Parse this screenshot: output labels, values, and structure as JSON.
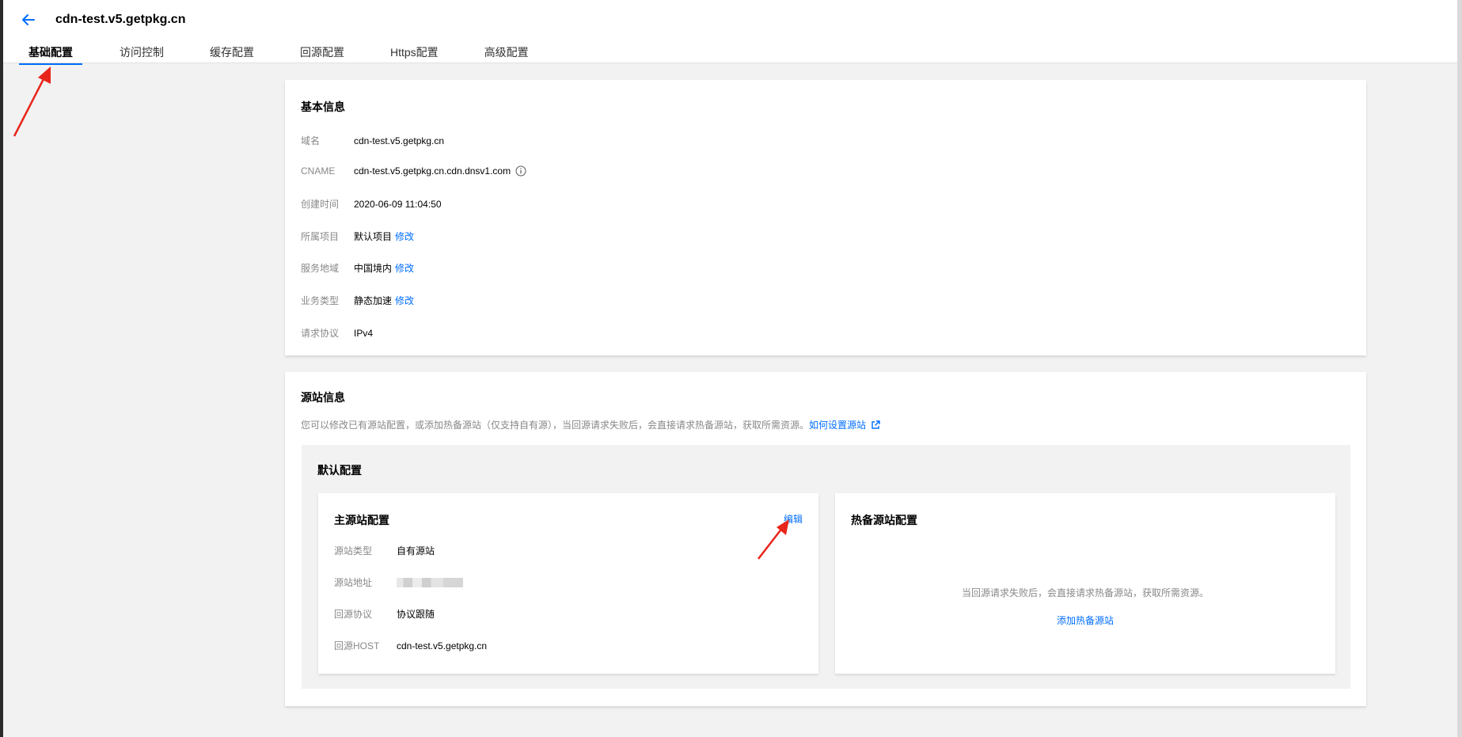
{
  "header": {
    "title": "cdn-test.v5.getpkg.cn",
    "tabs": [
      {
        "label": "基础配置"
      },
      {
        "label": "访问控制"
      },
      {
        "label": "缓存配置"
      },
      {
        "label": "回源配置"
      },
      {
        "label": "Https配置"
      },
      {
        "label": "高级配置"
      }
    ]
  },
  "basic": {
    "title": "基本信息",
    "rows": [
      {
        "key": "域名",
        "value": "cdn-test.v5.getpkg.cn"
      },
      {
        "key": "CNAME",
        "value": "cdn-test.v5.getpkg.cn.cdn.dnsv1.com"
      },
      {
        "key": "创建时间",
        "value": "2020-06-09 11:04:50"
      },
      {
        "key": "所属项目",
        "value": "默认项目",
        "link": "修改"
      },
      {
        "key": "服务地域",
        "value": "中国境内",
        "link": "修改"
      },
      {
        "key": "业务类型",
        "value": "静态加速",
        "link": "修改"
      },
      {
        "key": "请求协议",
        "value": "IPv4"
      }
    ]
  },
  "origin": {
    "title": "源站信息",
    "desc": "您可以修改已有源站配置，或添加热备源站（仅支持自有源），当回源请求失败后，会直接请求热备源站，获取所需资源。",
    "help_link": "如何设置源站",
    "default_title": "默认配置",
    "main": {
      "title": "主源站配置",
      "edit": "编辑",
      "rows": [
        {
          "key": "源站类型",
          "value": "自有源站"
        },
        {
          "key": "源站地址",
          "value": ""
        },
        {
          "key": "回源协议",
          "value": "协议跟随"
        },
        {
          "key": "回源HOST",
          "value": "cdn-test.v5.getpkg.cn"
        }
      ]
    },
    "backup": {
      "title": "热备源站配置",
      "empty_text": "当回源请求失败后，会直接请求热备源站，获取所需资源。",
      "add_link": "添加热备源站"
    }
  },
  "colors": {
    "accent": "#006eff",
    "annotation_arrow": "#e8251b"
  }
}
